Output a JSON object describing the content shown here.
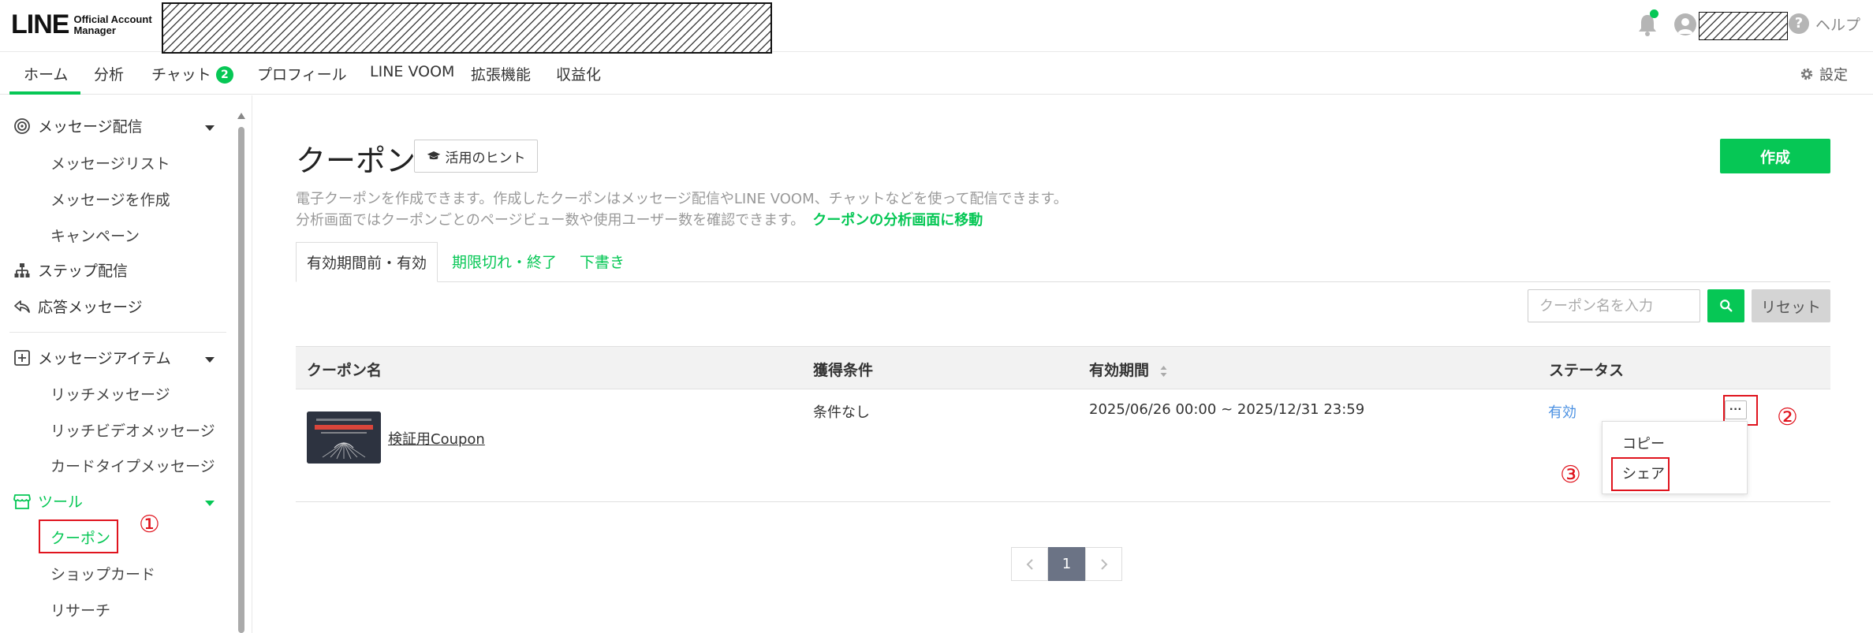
{
  "header": {
    "logo_main": "LINE",
    "logo_sub_line1": "Official Account",
    "logo_sub_line2": "Manager",
    "help_label": "ヘルプ"
  },
  "nav": {
    "items": [
      {
        "label": "ホーム"
      },
      {
        "label": "分析"
      },
      {
        "label": "チャット",
        "badge": "2"
      },
      {
        "label": "プロフィール"
      },
      {
        "label": "LINE VOOM"
      },
      {
        "label": "拡張機能"
      },
      {
        "label": "収益化"
      }
    ],
    "settings_label": "設定"
  },
  "sidebar": {
    "message_delivery": "メッセージ配信",
    "message_list": "メッセージリスト",
    "create_message": "メッセージを作成",
    "campaign": "キャンペーン",
    "step_delivery": "ステップ配信",
    "response_message": "応答メッセージ",
    "message_items": "メッセージアイテム",
    "rich_message": "リッチメッセージ",
    "rich_video_message": "リッチビデオメッセージ",
    "card_type_message": "カードタイプメッセージ",
    "tools": "ツール",
    "coupon": "クーポン",
    "shop_card": "ショップカード",
    "research": "リサーチ"
  },
  "annotations": {
    "num1": "①",
    "num2": "②",
    "num3": "③"
  },
  "main": {
    "title": "クーポン",
    "hint_label": "活用のヒント",
    "create_label": "作成",
    "desc_line1": "電子クーポンを作成できます。作成したクーポンはメッセージ配信やLINE VOOM、チャットなどを使って配信できます。",
    "desc_line2": "分析画面ではクーポンごとのページビュー数や使用ユーザー数を確認できます。",
    "desc_link": "クーポンの分析画面に移動",
    "tabs": [
      {
        "label": "有効期間前・有効"
      },
      {
        "label": "期限切れ・終了"
      },
      {
        "label": "下書き"
      }
    ],
    "search_placeholder": "クーポン名を入力",
    "reset_label": "リセット"
  },
  "table": {
    "headers": {
      "name": "クーポン名",
      "condition": "獲得条件",
      "period": "有効期間",
      "status": "ステータス"
    },
    "rows": [
      {
        "name": "検証用Coupon",
        "condition": "条件なし",
        "period": "2025/06/26 00:00 ~ 2025/12/31 23:59",
        "status": "有効",
        "more": "···"
      }
    ]
  },
  "dropdown": {
    "copy": "コピー",
    "share": "シェア"
  },
  "pagination": {
    "current": "1"
  },
  "colors": {
    "accent": "#06c755",
    "annotation_red": "#e0141e",
    "status_link": "#4a90e2"
  }
}
